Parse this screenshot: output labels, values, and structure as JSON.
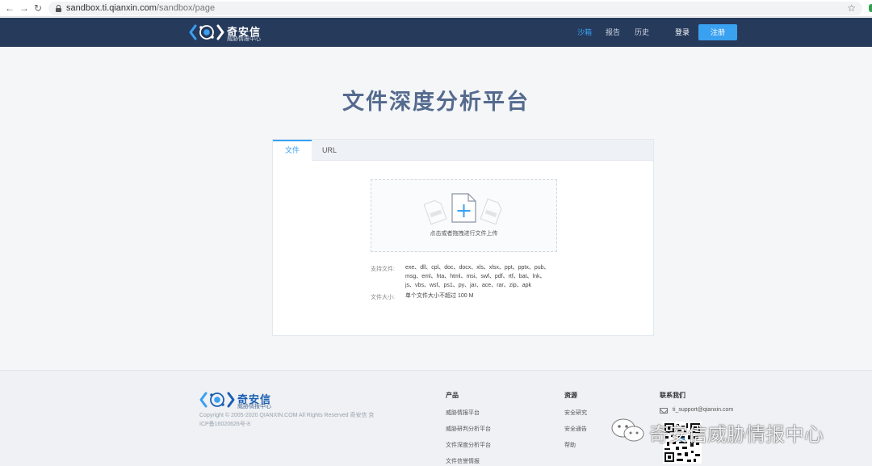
{
  "browser": {
    "url_host": "sandbox.ti.qianxin.com",
    "url_path": "/sandbox/page"
  },
  "header": {
    "logo_cn": "奇安信",
    "logo_sub": "威胁情报中心",
    "nav": [
      {
        "label": "沙箱",
        "active": true
      },
      {
        "label": "报告",
        "active": false
      },
      {
        "label": "历史",
        "active": false
      }
    ],
    "login": "登录",
    "register": "注册"
  },
  "main": {
    "title": "文件深度分析平台",
    "tabs": [
      {
        "label": "文件",
        "active": true
      },
      {
        "label": "URL",
        "active": false
      }
    ],
    "dropzone_text": "点击或者拖拽进行文件上传",
    "support_label": "支持文件:",
    "support_lines": [
      "exe、dll、cpl、doc、docx、xls、xlsx、ppt、pptx、pub、",
      "msg、eml、hta、html、msi、swf、pdf、rtf、bat、lnk、",
      "js、vbs、wsf、ps1、py、jar、ace、rar、zip、apk"
    ],
    "size_label": "文件大小:",
    "size_value": "单个文件大小不超过 100 M"
  },
  "footer": {
    "logo_cn": "奇安信",
    "logo_sub": "威胁情报中心",
    "copyright": "Copyright © 2005-2020 QIANXIN.COM All Rights Reserved 奇安信 京ICP备16020626号-8",
    "products": {
      "heading": "产品",
      "links": [
        "威胁情报平台",
        "威胁研判分析平台",
        "文件深度分析平台",
        "文件信誉情报"
      ]
    },
    "resources": {
      "heading": "资源",
      "links": [
        "安全研究",
        "安全通告",
        "帮助"
      ]
    },
    "contact": {
      "heading": "联系我们",
      "email": "ti_support@qianxin.com"
    }
  },
  "watermark": {
    "text": "奇安信威胁情报中心"
  },
  "colors": {
    "header_bg": "#263a5c",
    "accent": "#3aa0f0",
    "title": "#546a8e"
  }
}
